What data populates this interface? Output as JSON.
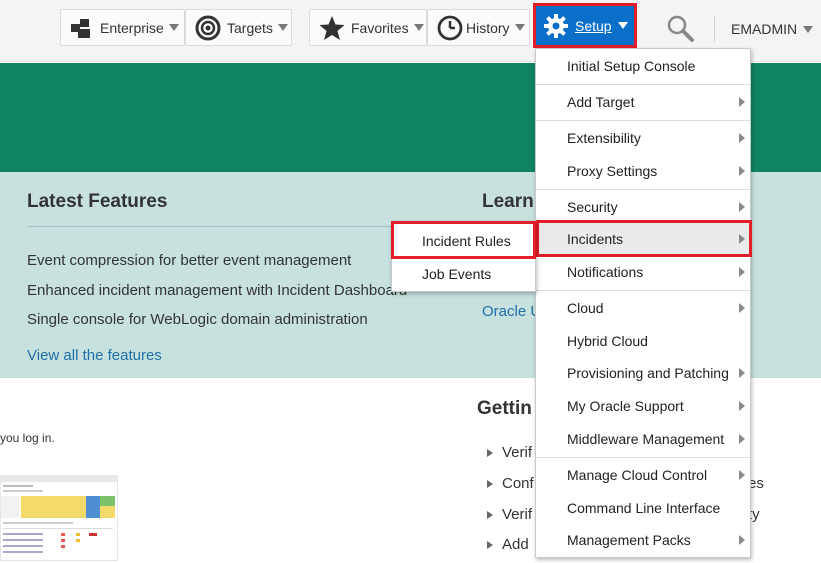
{
  "nav": {
    "enterprise": "Enterprise",
    "targets": "Targets",
    "favorites": "Favorites",
    "history": "History",
    "setup": "Setup",
    "user": "EMADMIN"
  },
  "features": {
    "title": "Latest Features",
    "items": [
      "Event compression for better event management",
      "Enhanced incident management with Incident Dashboard",
      "Single console for WebLogic domain administration"
    ],
    "link": "View all the features"
  },
  "learn": {
    "title": "Learn",
    "link": "Oracle U"
  },
  "getting_started": {
    "title": "Gettin",
    "items": [
      "Verif",
      "Conf",
      "Verif",
      "Add"
    ],
    "tails": [
      "es",
      "ty"
    ]
  },
  "login_text": "you log in.",
  "setup_menu": {
    "items": [
      {
        "label": "Initial Setup Console",
        "submenu": false
      },
      {
        "label": "Add Target",
        "submenu": true
      },
      {
        "label": "Extensibility",
        "submenu": true
      },
      {
        "label": "Proxy Settings",
        "submenu": true
      },
      {
        "label": "Security",
        "submenu": true
      },
      {
        "label": "Incidents",
        "submenu": true
      },
      {
        "label": "Notifications",
        "submenu": true
      },
      {
        "label": "Cloud",
        "submenu": true
      },
      {
        "label": "Hybrid Cloud",
        "submenu": false
      },
      {
        "label": "Provisioning and Patching",
        "submenu": true
      },
      {
        "label": "My Oracle Support",
        "submenu": true
      },
      {
        "label": "Middleware Management",
        "submenu": true
      },
      {
        "label": "Manage Cloud Control",
        "submenu": true
      },
      {
        "label": "Command Line Interface",
        "submenu": false
      },
      {
        "label": "Management Packs",
        "submenu": true
      }
    ]
  },
  "incidents_submenu": {
    "items": [
      "Incident Rules",
      "Job Events"
    ]
  },
  "colors": {
    "accent": "#0a6fc9",
    "highlight_border": "#e21e2b",
    "banner": "#0f8463",
    "panel": "#c7e1df",
    "link": "#1f6fa8"
  },
  "icons": {
    "enterprise": "enterprise-blocks-icon",
    "targets": "target-icon",
    "favorites": "star-icon",
    "history": "clock-icon",
    "setup": "gear-icon",
    "search": "search-icon"
  }
}
